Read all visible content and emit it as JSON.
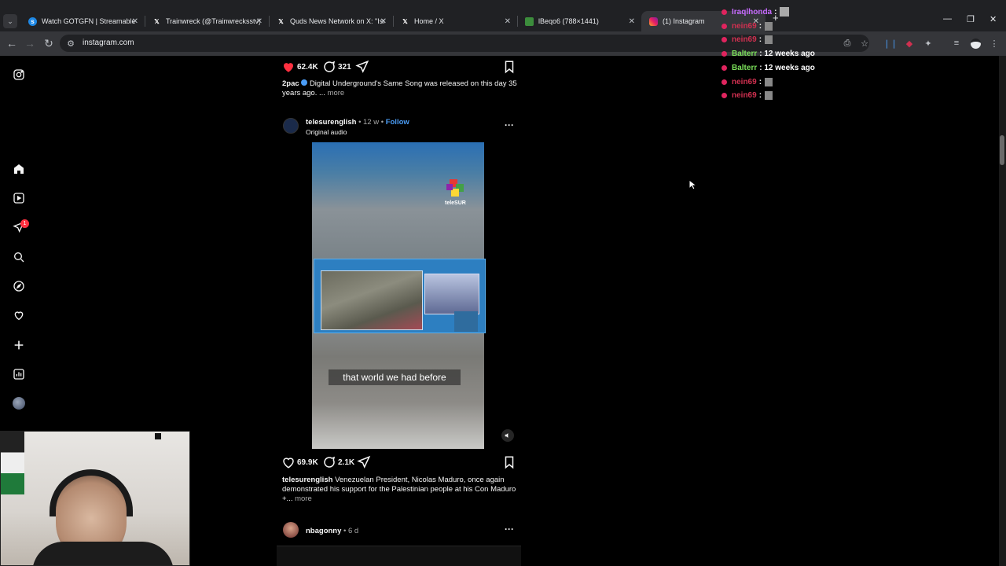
{
  "browser": {
    "tabs": [
      {
        "title": "Watch GOTGFN | Streamable",
        "icon": "streamable-icon"
      },
      {
        "title": "Trainwreck (@Trainwrecksstv) / X",
        "icon": "x-icon"
      },
      {
        "title": "Quds News Network on X: \"Isra",
        "icon": "x-icon"
      },
      {
        "title": "Home / X",
        "icon": "x-icon"
      },
      {
        "title": "lBeqo6 (788×1441)",
        "icon": "image-icon"
      },
      {
        "title": "(1) Instagram",
        "icon": "instagram-icon"
      }
    ],
    "url": "instagram.com"
  },
  "chat": [
    {
      "user": "Iraqlhonda",
      "message": ":",
      "color": "#c86cff"
    },
    {
      "user": "nein69",
      "message": ":",
      "color": "#d03050"
    },
    {
      "user": "nein69",
      "message": ":",
      "color": "#d03050"
    },
    {
      "user": "Balterr",
      "message": ": 12 weeks ago",
      "color": "#7be05a"
    },
    {
      "user": "Balterr",
      "message": ": 12 weeks ago",
      "color": "#7be05a"
    },
    {
      "user": "nein69",
      "message": ":",
      "color": "#d03050"
    },
    {
      "user": "nein69",
      "message": ":",
      "color": "#d03050"
    }
  ],
  "post1": {
    "likes": "62.4K",
    "comments": "321",
    "caption_user": "2pac",
    "caption_text": "Digital Underground's Same Song was released on this day 35",
    "caption_text2": "years ago. ...",
    "more": "more"
  },
  "post2": {
    "username": "telesurenglish",
    "time": "• 12 w •",
    "follow": "Follow",
    "audio": "Original audio",
    "logo_text": "teleSUR",
    "subtitle": "that world we had before",
    "likes": "69.9K",
    "comments": "2.1K",
    "caption_user": "telesurenglish",
    "caption_text": "Venezuelan President, Nicolas Maduro, once again",
    "caption_text2": "demonstrated his support for the Palestinian people at his Con Maduro",
    "caption_text3": "+...",
    "more": "more"
  },
  "post3": {
    "username": "nbagonny",
    "time": "• 6 d"
  },
  "colors": {
    "like_red": "#ff3040",
    "link_blue": "#4a9cf5"
  }
}
